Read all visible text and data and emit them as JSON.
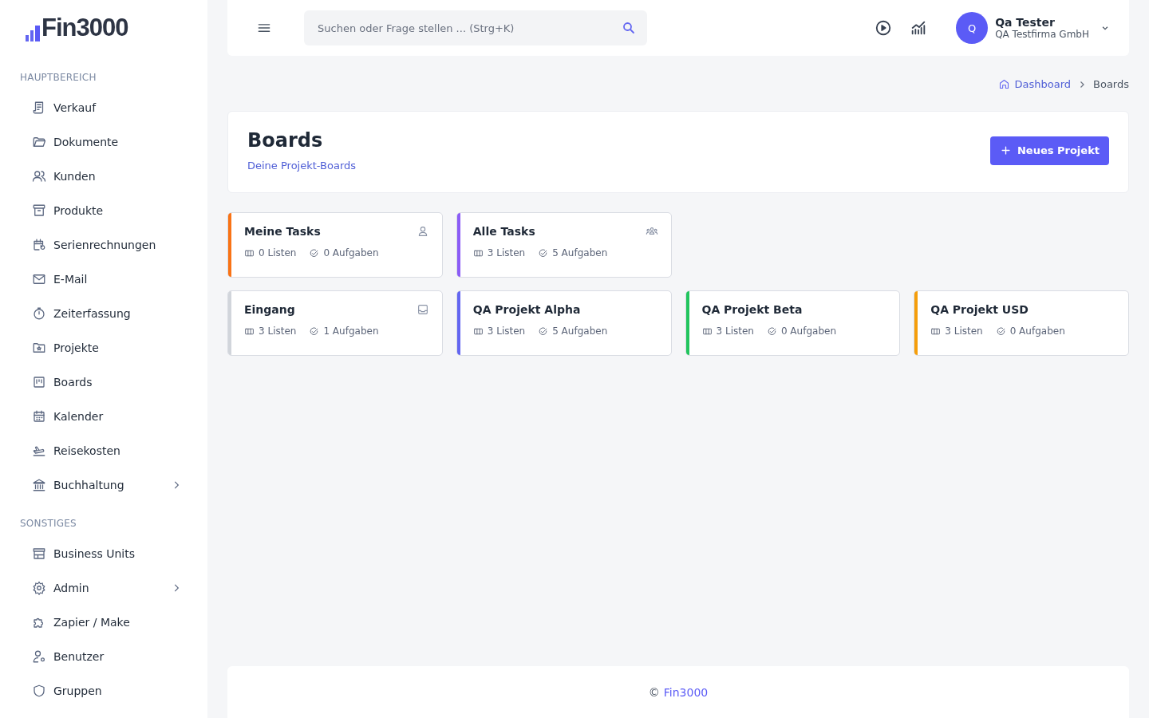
{
  "logo": {
    "text": "Fin3000"
  },
  "sidebar": {
    "sections": [
      {
        "title": "HAUPTBEREICH",
        "items": [
          {
            "label": "Verkauf",
            "expandable": false
          },
          {
            "label": "Dokumente",
            "expandable": false
          },
          {
            "label": "Kunden",
            "expandable": false
          },
          {
            "label": "Produkte",
            "expandable": false
          },
          {
            "label": "Serienrechnungen",
            "expandable": false
          },
          {
            "label": "E-Mail",
            "expandable": false
          },
          {
            "label": "Zeiterfassung",
            "expandable": false
          },
          {
            "label": "Projekte",
            "expandable": false
          },
          {
            "label": "Boards",
            "expandable": false
          },
          {
            "label": "Kalender",
            "expandable": false
          },
          {
            "label": "Reisekosten",
            "expandable": false
          },
          {
            "label": "Buchhaltung",
            "expandable": true
          }
        ]
      },
      {
        "title": "SONSTIGES",
        "items": [
          {
            "label": "Business Units",
            "expandable": false
          },
          {
            "label": "Admin",
            "expandable": true
          },
          {
            "label": "Zapier / Make",
            "expandable": false
          },
          {
            "label": "Benutzer",
            "expandable": false
          },
          {
            "label": "Gruppen",
            "expandable": false
          }
        ]
      }
    ]
  },
  "header": {
    "search": {
      "placeholder": "Suchen oder Frage stellen ... (Strg+K)"
    },
    "user": {
      "initial": "Q",
      "name": "Qa Tester",
      "company": "QA Testfirma GmbH"
    }
  },
  "breadcrumb": [
    "Dashboard",
    "Boards"
  ],
  "page": {
    "title": "Boards",
    "subtitle": "Deine Projekt-Boards",
    "button": "Neues Projekt"
  },
  "board_groups": [
    [
      {
        "kind": "personal",
        "title": "Meine Tasks",
        "color": "#f97316",
        "lists": "0 Listen",
        "tasks": "0 Aufgaben"
      },
      {
        "kind": "all",
        "title": "Alle Tasks",
        "color": "#8b5cf6",
        "lists": "3 Listen",
        "tasks": "5 Aufgaben"
      }
    ],
    [
      {
        "kind": "inbox",
        "title": "Eingang",
        "color": "#d1d5db",
        "lists": "3 Listen",
        "tasks": "1 Aufgaben"
      },
      {
        "kind": "project",
        "title": "QA Projekt Alpha",
        "color": "#6366f1",
        "lists": "3 Listen",
        "tasks": "5 Aufgaben"
      },
      {
        "kind": "project",
        "title": "QA Projekt Beta",
        "color": "#22c55e",
        "lists": "3 Listen",
        "tasks": "0 Aufgaben"
      },
      {
        "kind": "project",
        "title": "QA Projekt USD",
        "color": "#f59e0b",
        "lists": "3 Listen",
        "tasks": "0 Aufgaben"
      }
    ]
  ],
  "footer": {
    "symbol": "©",
    "link": "Fin3000"
  }
}
